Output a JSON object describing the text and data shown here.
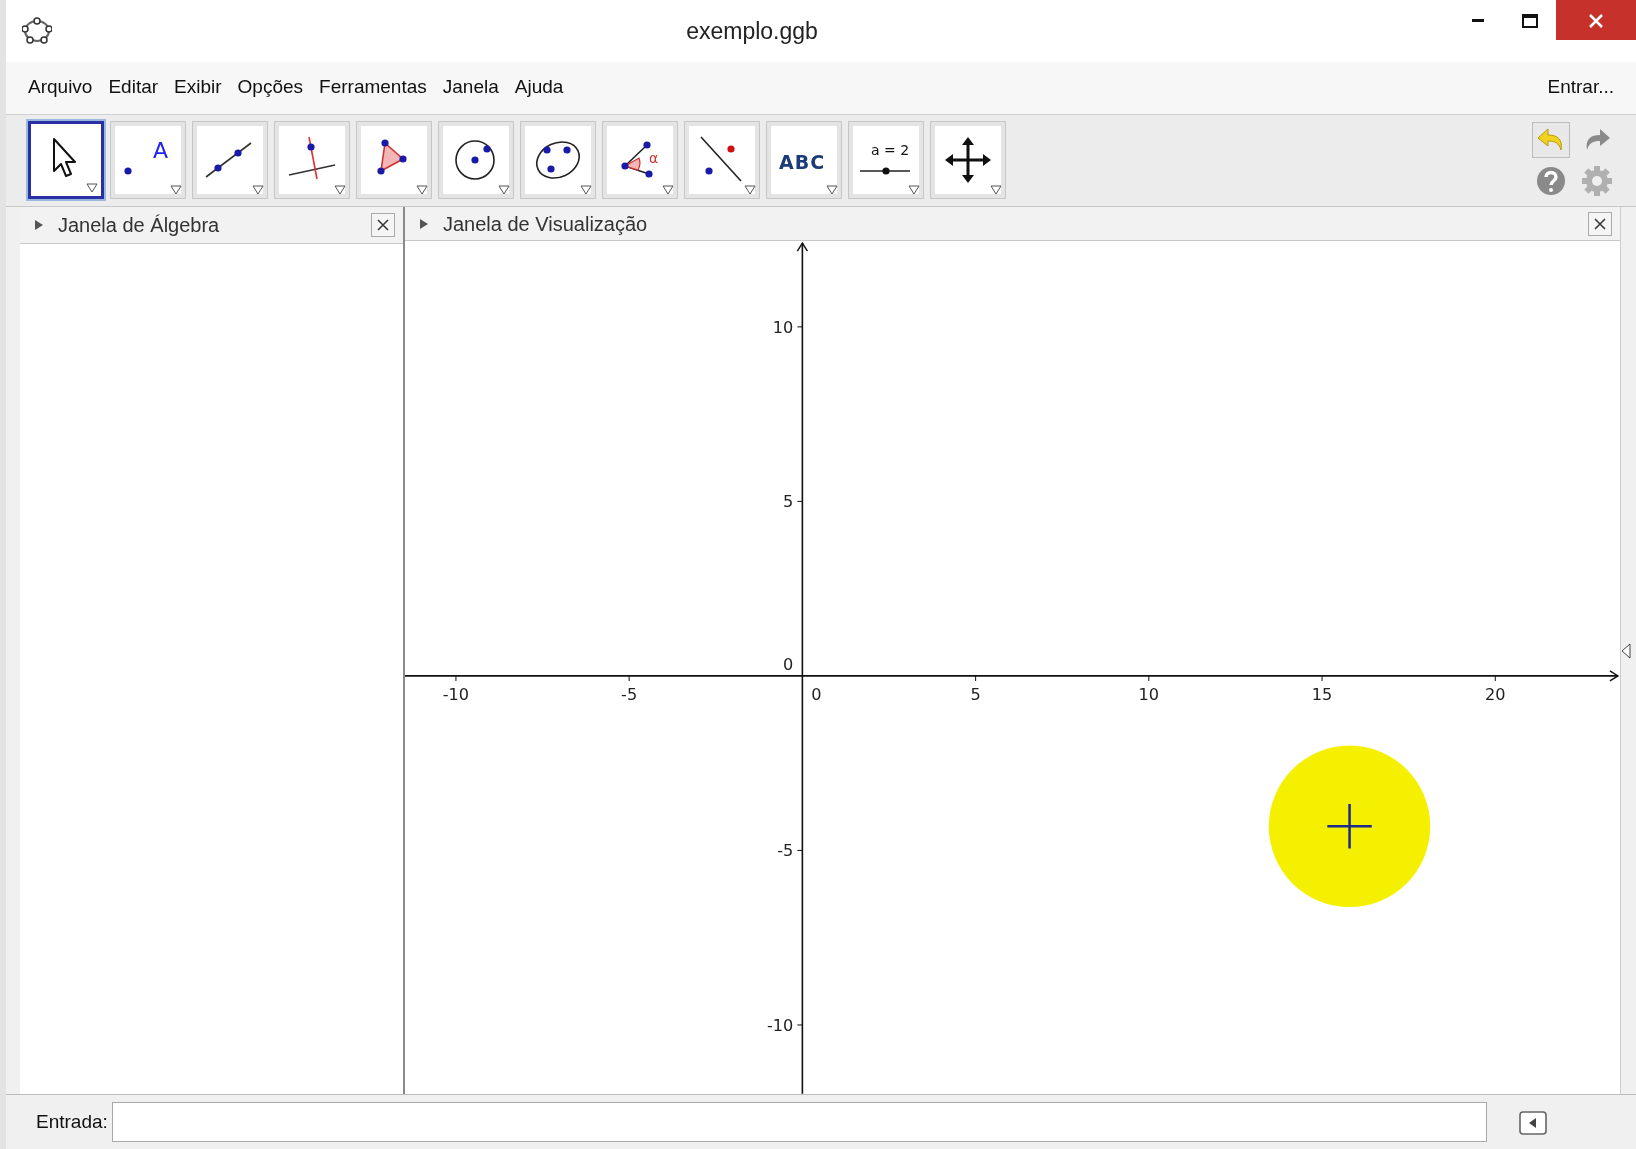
{
  "window": {
    "title": "exemplo.ggb"
  },
  "menu": [
    "Arquivo",
    "Editar",
    "Exibir",
    "Opções",
    "Ferramentas",
    "Janela",
    "Ajuda"
  ],
  "sign_in": "Entrar...",
  "tools": [
    {
      "kind": "move",
      "selected": true
    },
    {
      "kind": "point",
      "label": "A",
      "selected": false
    },
    {
      "kind": "line",
      "selected": false
    },
    {
      "kind": "perpendicular",
      "selected": false
    },
    {
      "kind": "polygon",
      "selected": false
    },
    {
      "kind": "circle",
      "selected": false
    },
    {
      "kind": "conic",
      "selected": false
    },
    {
      "kind": "angle",
      "label": "α",
      "selected": false
    },
    {
      "kind": "reflect",
      "selected": false
    },
    {
      "kind": "text",
      "label": "ABC",
      "selected": false
    },
    {
      "kind": "slider",
      "label": "a = 2",
      "selected": false
    },
    {
      "kind": "move-view",
      "selected": false
    }
  ],
  "panels": [
    {
      "title": "Janela de Álgebra"
    },
    {
      "title": "Janela de Visualização"
    }
  ],
  "graphics": {
    "chart_data": {
      "type": "scatter",
      "xlim": [
        -11.47,
        23.6
      ],
      "ylim": [
        -11.97,
        12.46
      ],
      "xticks": [
        -10,
        -5,
        5,
        10,
        15,
        20
      ],
      "yticks": [
        -10,
        -5,
        5,
        10
      ]
    },
    "origin_labels": [
      "0",
      "0"
    ]
  },
  "input_bar": {
    "label": "Entrada:"
  }
}
